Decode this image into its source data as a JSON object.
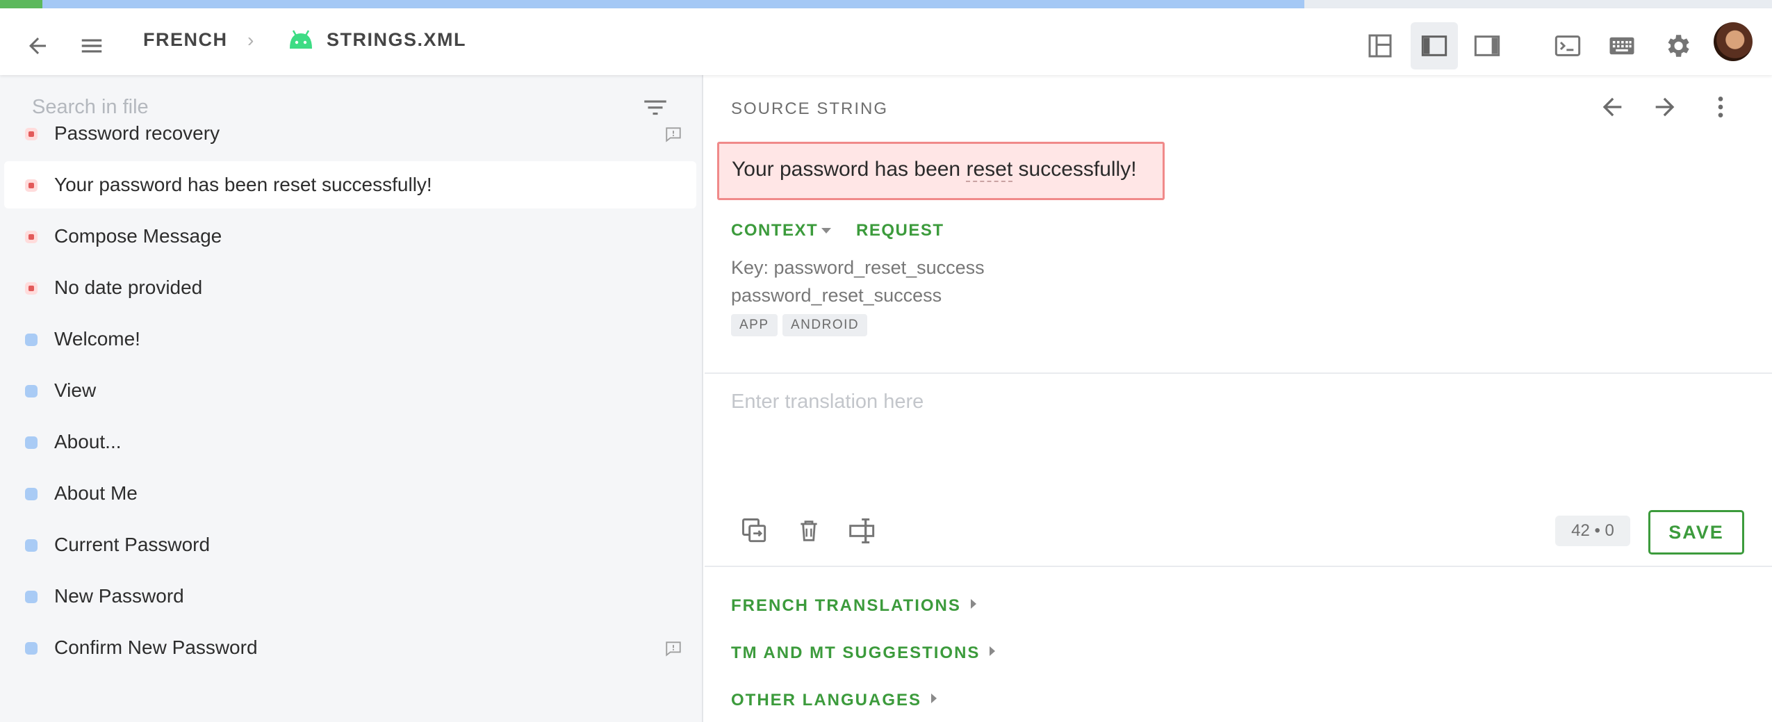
{
  "progress": {
    "approved_fraction": 0.024,
    "translated_fraction": 0.712,
    "approved_color": "#5cb85c",
    "translated_color": "#a4c8f5"
  },
  "header": {
    "project": "FRENCH",
    "file": "STRINGS.XML",
    "icons": [
      "back-arrow-icon",
      "menu-icon",
      "android-icon",
      "layout-icon",
      "sidebar-left-icon",
      "sidebar-right-icon",
      "terminal-icon",
      "keyboard-icon",
      "settings-icon"
    ]
  },
  "sidebar": {
    "search_placeholder": "Search in file",
    "strings": [
      {
        "label": "Password recovery",
        "status": "untranslated",
        "has_comment": true
      },
      {
        "label": "Your password has been reset successfully!",
        "status": "untranslated",
        "selected": true
      },
      {
        "label": "Compose Message",
        "status": "untranslated"
      },
      {
        "label": "No date provided",
        "status": "untranslated"
      },
      {
        "label": "Welcome!",
        "status": "translated"
      },
      {
        "label": "View",
        "status": "translated"
      },
      {
        "label": "About...",
        "status": "translated"
      },
      {
        "label": "About Me",
        "status": "translated"
      },
      {
        "label": "Current Password",
        "status": "translated"
      },
      {
        "label": "New Password",
        "status": "translated"
      },
      {
        "label": "Confirm New Password",
        "status": "translated",
        "has_comment": true
      }
    ]
  },
  "editor": {
    "section_title": "SOURCE STRING",
    "source_before": "Your password has been ",
    "source_term": "reset",
    "source_after": " successfully!",
    "context_label": "CONTEXT",
    "request_label": "REQUEST",
    "key_line": "Key: password_reset_success",
    "identifier": "password_reset_success",
    "tags": [
      "APP",
      "ANDROID"
    ],
    "translation_placeholder": "Enter translation here",
    "counter_source": "42",
    "counter_target": "0",
    "save_label": "SAVE"
  },
  "accordions": [
    "FRENCH TRANSLATIONS",
    "TM AND MT SUGGESTIONS",
    "OTHER LANGUAGES"
  ]
}
